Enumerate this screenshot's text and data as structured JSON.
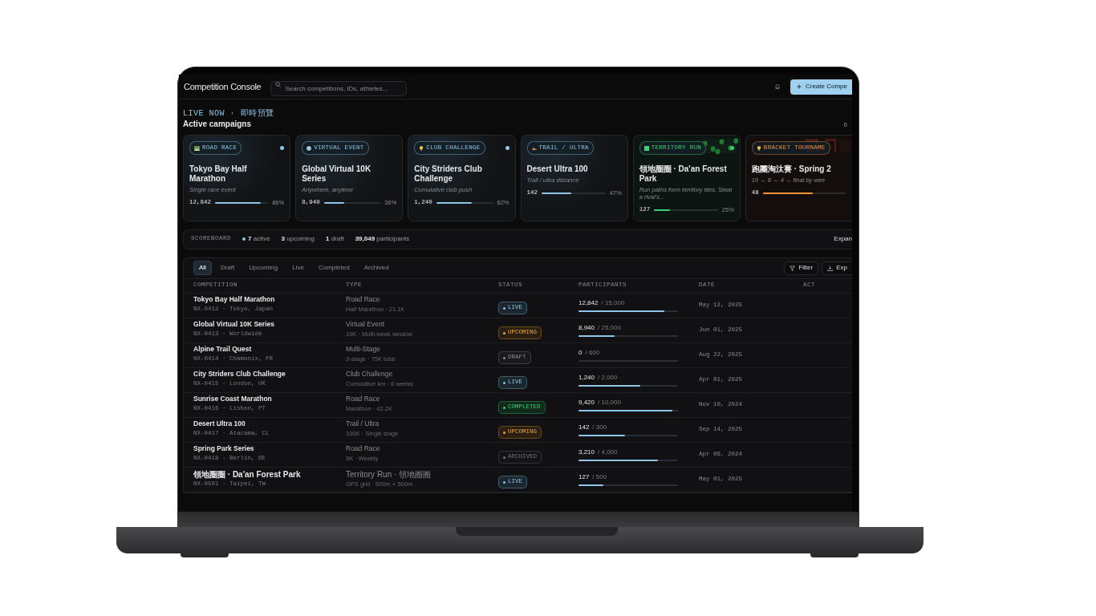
{
  "header": {
    "title": "Competition Console",
    "search": {
      "placeholder": "Search competitions, IDs, athletes..."
    },
    "create_button": "Create Compe"
  },
  "campaigns": {
    "eyebrow": "LIVE NOW · 即時預覽",
    "heading": "Active campaigns",
    "count": "6",
    "cards": [
      {
        "tag": "ROAD RACE",
        "kind": "road",
        "color": "#8ec5e8",
        "live": true,
        "title": "Tokyo Bay Half Marathon",
        "subtitle": "Single race event",
        "count": "12,842",
        "level": 0.86,
        "percent": "86%"
      },
      {
        "tag": "VIRTUAL EVENT",
        "kind": "virtual",
        "color": "#8ec5e8",
        "live": false,
        "title": "Global Virtual 10K Series",
        "subtitle": "Anywhere, anytime",
        "count": "8,940",
        "level": 0.36,
        "percent": "36%"
      },
      {
        "tag": "CLUB CHALLENGE",
        "kind": "club",
        "color": "#8ec5e8",
        "live": true,
        "title": "City Striders Club Challenge",
        "subtitle": "Cumulative club push",
        "count": "1,240",
        "level": 0.62,
        "percent": "62%"
      },
      {
        "tag": "TRAIL / ULTRA",
        "kind": "trail",
        "color": "#8ec5e8",
        "live": false,
        "title": "Desert Ultra 100",
        "subtitle": "Trail / ultra distance",
        "count": "142",
        "level": 0.47,
        "percent": "47%"
      },
      {
        "tag": "TERRITORY RUN",
        "kind": "territory",
        "color": "#3ecf7a",
        "live": true,
        "title": "領地圈圈 · Da'an Forest Park",
        "subtitle": "Run paths form territory tiles. Steal a rival's...",
        "count": "127",
        "level": 0.25,
        "percent": "25%"
      },
      {
        "tag": "BRACKET TOURNAME",
        "kind": "bracket",
        "color": "#f0953a",
        "live": false,
        "title": "跑團淘汰賽 · Spring 2",
        "subtitle": "16 → 8 → 4 → final by wee",
        "count": "48",
        "level": 0.6
      }
    ]
  },
  "scoreboard": {
    "label": "SCOREBOARD",
    "stats": [
      {
        "text": "**7** active",
        "dot": true
      },
      {
        "text": "**3** upcoming",
        "dot": false
      },
      {
        "text": "**1** draft",
        "dot": false
      },
      {
        "text": "**39,049** participants",
        "dot": false
      }
    ],
    "expand": "Expan"
  },
  "tabs": [
    {
      "label": "All",
      "selected": true
    },
    {
      "label": "Draft",
      "selected": false
    },
    {
      "label": "Upcoming",
      "selected": false
    },
    {
      "label": "Live",
      "selected": false
    },
    {
      "label": "Completed",
      "selected": false
    },
    {
      "label": "Archived",
      "selected": false
    }
  ],
  "toolbar": {
    "filter": "Filter",
    "export": "Exp"
  },
  "table": {
    "columns": [
      "COMPETITION",
      "TYPE",
      "STATUS",
      "PARTICIPANTS",
      "DATE",
      "ACT"
    ],
    "rows": [
      {
        "name": "Tokyo Bay Half Marathon",
        "meta": "NX-0412 · Tokyo, Japan",
        "type": "Road Race",
        "type_detail": "Half Marathon · 21.1K",
        "kind": "live",
        "status": "LIVE",
        "count": "12,842",
        "capacity": "/ 15,000",
        "level": 0.86,
        "date": "May 12, 2025"
      },
      {
        "name": "Global Virtual 10K Series",
        "meta": "NX-0413 · Worldwide",
        "type": "Virtual Event",
        "type_detail": "10K · Multi-week window",
        "kind": "upcoming",
        "status": "UPCOMING",
        "count": "8,940",
        "capacity": "/ 25,000",
        "level": 0.36,
        "date": "Jun 01, 2025"
      },
      {
        "name": "Alpine Trail Quest",
        "meta": "NX-0414 · Chamonix, FR",
        "type": "Multi-Stage",
        "type_detail": "3-stage · 75K total",
        "kind": "draft",
        "status": "DRAFT",
        "count": "0",
        "capacity": "/ 600",
        "level": 0,
        "date": "Aug 22, 2025"
      },
      {
        "name": "City Striders Club Challenge",
        "meta": "NX-0415 · London, UK",
        "type": "Club Challenge",
        "type_detail": "Cumulative km · 6 weeks",
        "kind": "live",
        "status": "LIVE",
        "count": "1,240",
        "capacity": "/ 2,000",
        "level": 0.62,
        "date": "Apr 01, 2025"
      },
      {
        "name": "Sunrise Coast Marathon",
        "meta": "NX-0416 · Lisbon, PT",
        "type": "Road Race",
        "type_detail": "Marathon · 42.2K",
        "kind": "completed",
        "status": "COMPLETED",
        "count": "9,420",
        "capacity": "/ 10,000",
        "level": 0.94,
        "date": "Nov 10, 2024"
      },
      {
        "name": "Desert Ultra 100",
        "meta": "NX-0417 · Atacama, CL",
        "type": "Trail / Ultra",
        "type_detail": "100K · Single stage",
        "kind": "upcoming",
        "status": "UPCOMING",
        "count": "142",
        "capacity": "/ 300",
        "level": 0.47,
        "date": "Sep 14, 2025"
      },
      {
        "name": "Spring Park Series",
        "meta": "NX-0418 · Berlin, DE",
        "type": "Road Race",
        "type_detail": "5K · Weekly",
        "kind": "archived",
        "status": "ARCHIVED",
        "count": "3,210",
        "capacity": "/ 4,000",
        "level": 0.8,
        "date": "Apr 06, 2024"
      },
      {
        "name": "領地圈圈 · Da'an Forest Park",
        "meta": "NX-0501 · Taipei, TW",
        "type": "Territory Run · 領地圈圈",
        "type_detail": "GPS grid · 500m × 500m",
        "kind": "live",
        "status": "LIVE",
        "count": "127",
        "capacity": "/ 500",
        "level": 0.25,
        "date": "May 01, 2025"
      }
    ]
  }
}
